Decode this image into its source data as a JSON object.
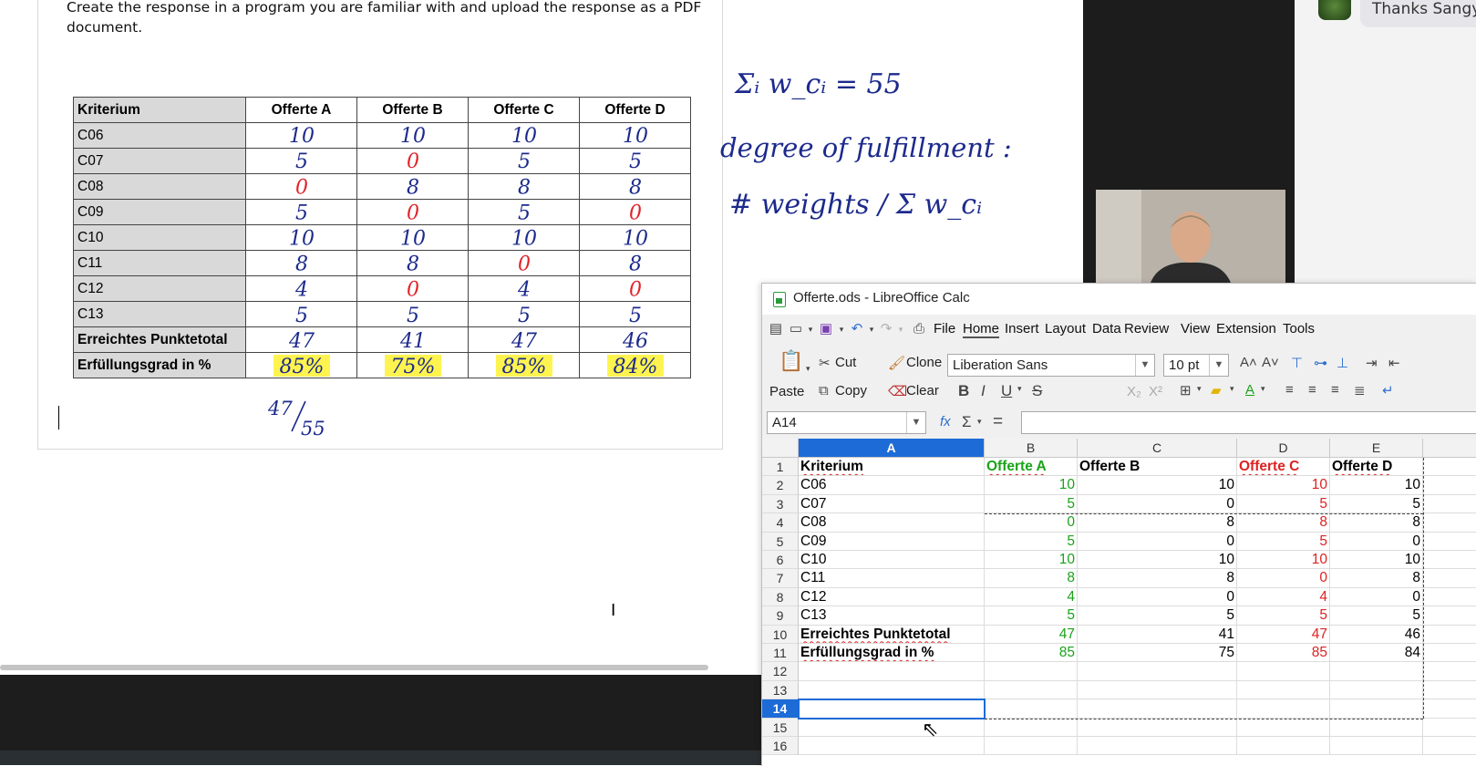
{
  "document": {
    "instruction": "Create the response in a program you are familiar with and upload the response as a PDF document.",
    "table": {
      "headers": [
        "Kriterium",
        "Offerte A",
        "Offerte B",
        "Offerte C",
        "Offerte D"
      ],
      "rows": [
        {
          "label": "C06",
          "bold": false
        },
        {
          "label": "C07",
          "bold": false
        },
        {
          "label": "C08",
          "bold": false
        },
        {
          "label": "C09",
          "bold": false
        },
        {
          "label": "C10",
          "bold": false
        },
        {
          "label": "C11",
          "bold": false
        },
        {
          "label": "C12",
          "bold": false
        },
        {
          "label": "C13",
          "bold": false
        },
        {
          "label": "Erreichtes Punktetotal",
          "bold": true
        },
        {
          "label": "Erfüllungsgrad in %",
          "bold": true
        }
      ]
    },
    "handwriting": {
      "grid": [
        [
          "10",
          "10",
          "10",
          "10"
        ],
        [
          "5",
          "0",
          "5",
          "5"
        ],
        [
          "0",
          "8",
          "8",
          "8"
        ],
        [
          "5",
          "0",
          "5",
          "0"
        ],
        [
          "10",
          "10",
          "10",
          "10"
        ],
        [
          "8",
          "8",
          "0",
          "8"
        ],
        [
          "4",
          "0",
          "4",
          "0"
        ],
        [
          "5",
          "5",
          "5",
          "5"
        ],
        [
          "47",
          "41",
          "47",
          "46"
        ],
        [
          "85%",
          "75%",
          "85%",
          "84%"
        ]
      ],
      "red_cells": [
        [
          1,
          1
        ],
        [
          2,
          0
        ],
        [
          3,
          1
        ],
        [
          3,
          3
        ],
        [
          5,
          2
        ],
        [
          6,
          1
        ],
        [
          6,
          3
        ]
      ],
      "fraction_numerator": "47",
      "fraction_denominator": "55",
      "notes": [
        "Σᵢ w_cᵢ = 55",
        "degree of fulfillment :",
        "# weights / Σ w_cᵢ"
      ],
      "ink_color": "#1c2a8c",
      "red_ink_color": "#e0242a",
      "highlight_color": "#fff44f"
    }
  },
  "chat": {
    "message": "Thanks Sangy"
  },
  "calc": {
    "title": "Offerte.ods - LibreOffice Calc",
    "menu": [
      "File",
      "Home",
      "Insert",
      "Layout",
      "Data",
      "Review",
      "View",
      "Extension",
      "Tools"
    ],
    "toolbar": {
      "paste": "Paste",
      "cut": "Cut",
      "copy": "Copy",
      "clone": "Clone",
      "clear": "Clear",
      "font_name": "Liberation Sans",
      "font_size": "10 pt"
    },
    "name_box": "A14",
    "formula": "",
    "columns": [
      "A",
      "B",
      "C",
      "D",
      "E"
    ],
    "selected_column": "A",
    "selected_row": "14",
    "row_numbers": [
      "1",
      "2",
      "3",
      "4",
      "5",
      "6",
      "7",
      "8",
      "9",
      "10",
      "11",
      "12",
      "13",
      "14",
      "15",
      "16"
    ],
    "rows": [
      [
        "Kriterium",
        "Offerte A",
        "Offerte B",
        "Offerte C",
        "Offerte D"
      ],
      [
        "C06",
        "10",
        "10",
        "10",
        "10"
      ],
      [
        "C07",
        "5",
        "0",
        "5",
        "5"
      ],
      [
        "C08",
        "0",
        "8",
        "8",
        "8"
      ],
      [
        "C09",
        "5",
        "0",
        "5",
        "0"
      ],
      [
        "C10",
        "10",
        "10",
        "10",
        "10"
      ],
      [
        "C11",
        "8",
        "8",
        "0",
        "8"
      ],
      [
        "C12",
        "4",
        "0",
        "4",
        "0"
      ],
      [
        "C13",
        "5",
        "5",
        "5",
        "5"
      ],
      [
        "Erreichtes Punktetotal",
        "47",
        "41",
        "47",
        "46"
      ],
      [
        "Erfüllungsgrad in %",
        "85",
        "75",
        "85",
        "84"
      ]
    ],
    "colors": {
      "offerte_a": "#1aa31a",
      "offerte_c": "#dd2222",
      "selection": "#1d6bd6"
    }
  }
}
